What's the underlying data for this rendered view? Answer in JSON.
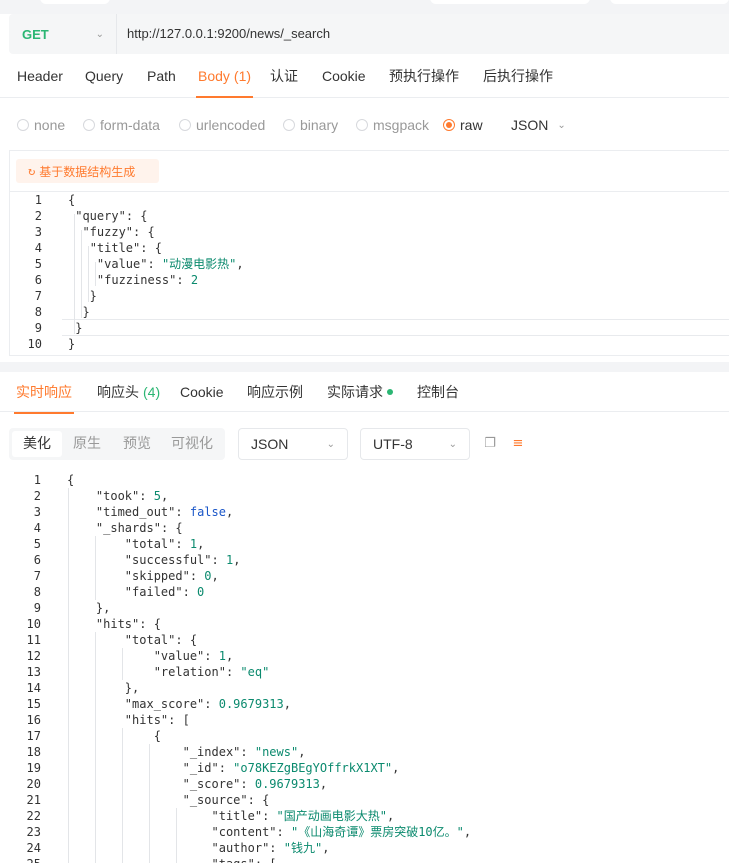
{
  "request": {
    "method": "GET",
    "url": "http://127.0.0.1:9200/news/_search"
  },
  "request_tabs": [
    {
      "label": "Header"
    },
    {
      "label": "Query"
    },
    {
      "label": "Path"
    },
    {
      "label": "Body",
      "count": "(1)"
    },
    {
      "label": "认证"
    },
    {
      "label": "Cookie"
    },
    {
      "label": "预执行操作"
    },
    {
      "label": "后执行操作"
    }
  ],
  "body_types": [
    {
      "label": "none"
    },
    {
      "label": "form-data"
    },
    {
      "label": "urlencoded"
    },
    {
      "label": "binary"
    },
    {
      "label": "msgpack"
    },
    {
      "label": "raw",
      "checked": true
    }
  ],
  "raw_format": "JSON",
  "generate_button": "基于数据结构生成",
  "request_body": [
    {
      "n": "1",
      "parts": [
        [
          "p",
          "{"
        ]
      ]
    },
    {
      "n": "2",
      "parts": [
        [
          "p",
          " "
        ],
        [
          "k",
          "\"query\""
        ],
        [
          "p",
          ": {"
        ]
      ]
    },
    {
      "n": "3",
      "parts": [
        [
          "p",
          "  "
        ],
        [
          "k",
          "\"fuzzy\""
        ],
        [
          "p",
          ": {"
        ]
      ]
    },
    {
      "n": "4",
      "parts": [
        [
          "p",
          "   "
        ],
        [
          "k",
          "\"title\""
        ],
        [
          "p",
          ": {"
        ]
      ]
    },
    {
      "n": "5",
      "parts": [
        [
          "p",
          "    "
        ],
        [
          "k",
          "\"value\""
        ],
        [
          "p",
          ": "
        ],
        [
          "s",
          "\"动漫电影热\""
        ],
        [
          "p",
          ","
        ]
      ]
    },
    {
      "n": "6",
      "parts": [
        [
          "p",
          "    "
        ],
        [
          "k",
          "\"fuzziness\""
        ],
        [
          "p",
          ": "
        ],
        [
          "n",
          "2"
        ]
      ]
    },
    {
      "n": "7",
      "parts": [
        [
          "p",
          "   }"
        ]
      ]
    },
    {
      "n": "8",
      "parts": [
        [
          "p",
          "  }"
        ]
      ]
    },
    {
      "n": "9",
      "parts": [
        [
          "p",
          " }"
        ]
      ]
    },
    {
      "n": "10",
      "parts": [
        [
          "p",
          "}"
        ]
      ]
    }
  ],
  "response_tabs": [
    {
      "label": "实时响应",
      "active": true
    },
    {
      "label": "响应头",
      "count": "(4)"
    },
    {
      "label": "Cookie"
    },
    {
      "label": "响应示例"
    },
    {
      "label": "实际请求",
      "dot": true
    },
    {
      "label": "控制台"
    }
  ],
  "view_modes": [
    "美化",
    "原生",
    "预览",
    "可视化"
  ],
  "response_format": "JSON",
  "response_encoding": "UTF-8",
  "response_body": [
    {
      "n": "1",
      "parts": [
        [
          "p",
          "{"
        ]
      ]
    },
    {
      "n": "2",
      "parts": [
        [
          "p",
          "    "
        ],
        [
          "k",
          "\"took\""
        ],
        [
          "p",
          ": "
        ],
        [
          "n",
          "5"
        ],
        [
          "p",
          ","
        ]
      ]
    },
    {
      "n": "3",
      "parts": [
        [
          "p",
          "    "
        ],
        [
          "k",
          "\"timed_out\""
        ],
        [
          "p",
          ": "
        ],
        [
          "b",
          "false"
        ],
        [
          "p",
          ","
        ]
      ]
    },
    {
      "n": "4",
      "parts": [
        [
          "p",
          "    "
        ],
        [
          "k",
          "\"_shards\""
        ],
        [
          "p",
          ": {"
        ]
      ]
    },
    {
      "n": "5",
      "parts": [
        [
          "p",
          "        "
        ],
        [
          "k",
          "\"total\""
        ],
        [
          "p",
          ": "
        ],
        [
          "n",
          "1"
        ],
        [
          "p",
          ","
        ]
      ]
    },
    {
      "n": "6",
      "parts": [
        [
          "p",
          "        "
        ],
        [
          "k",
          "\"successful\""
        ],
        [
          "p",
          ": "
        ],
        [
          "n",
          "1"
        ],
        [
          "p",
          ","
        ]
      ]
    },
    {
      "n": "7",
      "parts": [
        [
          "p",
          "        "
        ],
        [
          "k",
          "\"skipped\""
        ],
        [
          "p",
          ": "
        ],
        [
          "n",
          "0"
        ],
        [
          "p",
          ","
        ]
      ]
    },
    {
      "n": "8",
      "parts": [
        [
          "p",
          "        "
        ],
        [
          "k",
          "\"failed\""
        ],
        [
          "p",
          ": "
        ],
        [
          "n",
          "0"
        ]
      ]
    },
    {
      "n": "9",
      "parts": [
        [
          "p",
          "    },"
        ]
      ]
    },
    {
      "n": "10",
      "parts": [
        [
          "p",
          "    "
        ],
        [
          "k",
          "\"hits\""
        ],
        [
          "p",
          ": {"
        ]
      ]
    },
    {
      "n": "11",
      "parts": [
        [
          "p",
          "        "
        ],
        [
          "k",
          "\"total\""
        ],
        [
          "p",
          ": {"
        ]
      ]
    },
    {
      "n": "12",
      "parts": [
        [
          "p",
          "            "
        ],
        [
          "k",
          "\"value\""
        ],
        [
          "p",
          ": "
        ],
        [
          "n",
          "1"
        ],
        [
          "p",
          ","
        ]
      ]
    },
    {
      "n": "13",
      "parts": [
        [
          "p",
          "            "
        ],
        [
          "k",
          "\"relation\""
        ],
        [
          "p",
          ": "
        ],
        [
          "s",
          "\"eq\""
        ]
      ]
    },
    {
      "n": "14",
      "parts": [
        [
          "p",
          "        },"
        ]
      ]
    },
    {
      "n": "15",
      "parts": [
        [
          "p",
          "        "
        ],
        [
          "k",
          "\"max_score\""
        ],
        [
          "p",
          ": "
        ],
        [
          "n",
          "0.9679313"
        ],
        [
          "p",
          ","
        ]
      ]
    },
    {
      "n": "16",
      "parts": [
        [
          "p",
          "        "
        ],
        [
          "k",
          "\"hits\""
        ],
        [
          "p",
          ": ["
        ]
      ]
    },
    {
      "n": "17",
      "parts": [
        [
          "p",
          "            {"
        ]
      ]
    },
    {
      "n": "18",
      "parts": [
        [
          "p",
          "                "
        ],
        [
          "k",
          "\"_index\""
        ],
        [
          "p",
          ": "
        ],
        [
          "s",
          "\"news\""
        ],
        [
          "p",
          ","
        ]
      ]
    },
    {
      "n": "19",
      "parts": [
        [
          "p",
          "                "
        ],
        [
          "k",
          "\"_id\""
        ],
        [
          "p",
          ": "
        ],
        [
          "s",
          "\"o78KEZgBEgYOffrkX1XT\""
        ],
        [
          "p",
          ","
        ]
      ]
    },
    {
      "n": "20",
      "parts": [
        [
          "p",
          "                "
        ],
        [
          "k",
          "\"_score\""
        ],
        [
          "p",
          ": "
        ],
        [
          "n",
          "0.9679313"
        ],
        [
          "p",
          ","
        ]
      ]
    },
    {
      "n": "21",
      "parts": [
        [
          "p",
          "                "
        ],
        [
          "k",
          "\"_source\""
        ],
        [
          "p",
          ": {"
        ]
      ]
    },
    {
      "n": "22",
      "parts": [
        [
          "p",
          "                    "
        ],
        [
          "k",
          "\"title\""
        ],
        [
          "p",
          ": "
        ],
        [
          "s",
          "\"国产动画电影大热\""
        ],
        [
          "p",
          ","
        ]
      ]
    },
    {
      "n": "23",
      "parts": [
        [
          "p",
          "                    "
        ],
        [
          "k",
          "\"content\""
        ],
        [
          "p",
          ": "
        ],
        [
          "s",
          "\"《山海奇谭》票房突破10亿。\""
        ],
        [
          "p",
          ","
        ]
      ]
    },
    {
      "n": "24",
      "parts": [
        [
          "p",
          "                    "
        ],
        [
          "k",
          "\"author\""
        ],
        [
          "p",
          ": "
        ],
        [
          "s",
          "\"钱九\""
        ],
        [
          "p",
          ","
        ]
      ]
    },
    {
      "n": "25",
      "parts": [
        [
          "p",
          "                    "
        ],
        [
          "k",
          "\"tags\""
        ],
        [
          "p",
          ": ["
        ]
      ]
    }
  ]
}
